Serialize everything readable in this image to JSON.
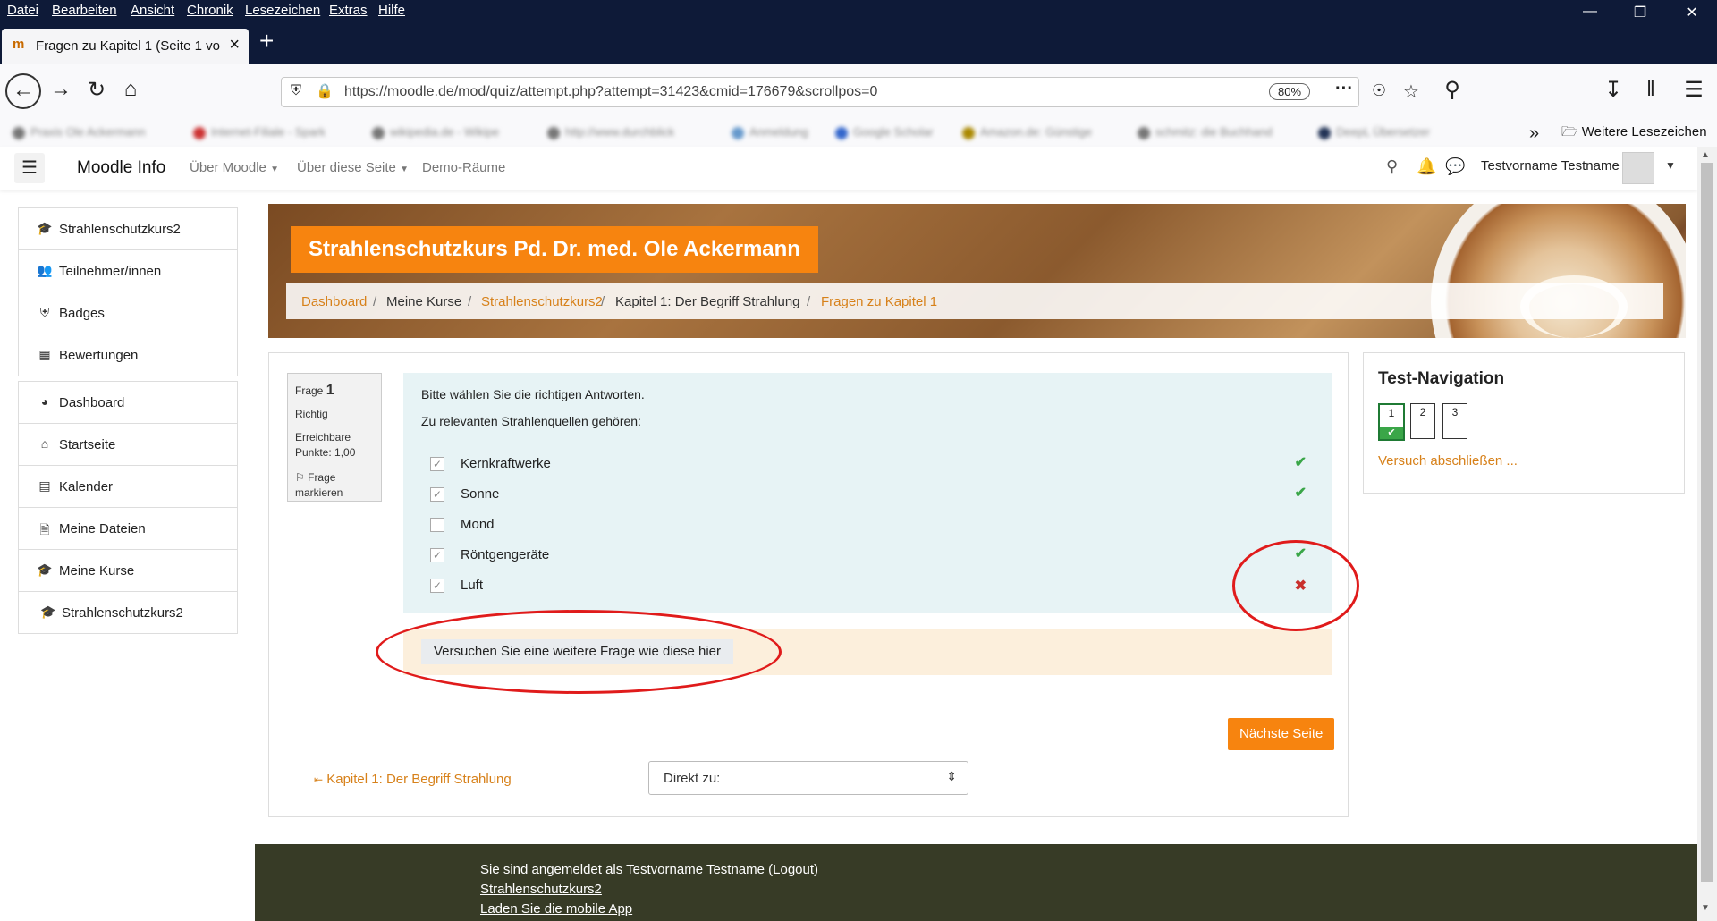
{
  "browser": {
    "menu": [
      "Datei",
      "Bearbeiten",
      "Ansicht",
      "Chronik",
      "Lesezeichen",
      "Extras",
      "Hilfe"
    ],
    "tab_title": "Fragen zu Kapitel 1 (Seite 1 von",
    "url": "https://moodle.de/mod/quiz/attempt.php?attempt=31423&cmid=176679&scrollpos=0",
    "zoom": "80%",
    "bookmarks_folder": "Weitere Lesezeichen",
    "bookmarks_blurred": [
      "Praxis Ole Ackermann",
      "Internet-Filiale - Spark",
      "wikipedia.de - Wikipe",
      "http://www.durchblick",
      "Anmeldung",
      "Google Scholar",
      "Amazon.de: Günstige",
      "schmitz: die Buchhand",
      "DeepL Übersetzer"
    ]
  },
  "moodle": {
    "brand": "Moodle Info",
    "nav": [
      "Über Moodle",
      "Über diese Seite",
      "Demo-Räume"
    ],
    "user_name": "Testvorname Testname"
  },
  "sidebar": {
    "items": [
      {
        "icon": "graduation-cap-icon",
        "label": "Strahlenschutzkurs2"
      },
      {
        "icon": "users-icon",
        "label": "Teilnehmer/innen"
      },
      {
        "icon": "badge-shield-icon",
        "label": "Badges"
      },
      {
        "icon": "table-icon",
        "label": "Bewertungen"
      },
      {
        "icon": "dashboard-icon",
        "label": "Dashboard"
      },
      {
        "icon": "home-icon",
        "label": "Startseite"
      },
      {
        "icon": "calendar-icon",
        "label": "Kalender"
      },
      {
        "icon": "file-icon",
        "label": "Meine Dateien"
      },
      {
        "icon": "graduation-cap-icon",
        "label": "Meine Kurse"
      },
      {
        "icon": "graduation-cap-icon",
        "label": "Strahlenschutzkurs2"
      }
    ]
  },
  "course": {
    "title": "Strahlenschutzkurs Pd. Dr. med. Ole Ackermann",
    "breadcrumb": [
      {
        "label": "Dashboard",
        "link": true
      },
      {
        "label": "Meine Kurse",
        "link": false
      },
      {
        "label": "Strahlenschutzkurs2",
        "link": true
      },
      {
        "label": "Kapitel 1: Der Begriff Strahlung",
        "link": false
      },
      {
        "label": "Fragen zu Kapitel 1",
        "link": true
      }
    ],
    "separator": "/"
  },
  "question": {
    "label": "Frage",
    "number": "1",
    "status": "Richtig",
    "points": "Erreichbare Punkte: 1,00",
    "flag": "Frage markieren",
    "instruction": "Bitte wählen Sie die richtigen Antworten.",
    "text": "Zu relevanten Strahlenquellen gehören:",
    "answers": [
      {
        "label": "Kernkraftwerke",
        "checked": true,
        "mark": "correct"
      },
      {
        "label": "Sonne",
        "checked": true,
        "mark": "correct"
      },
      {
        "label": "Mond",
        "checked": false,
        "mark": "none"
      },
      {
        "label": "Röntgengeräte",
        "checked": true,
        "mark": "correct"
      },
      {
        "label": "Luft",
        "checked": true,
        "mark": "incorrect"
      }
    ],
    "redo_label": "Versuchen Sie eine weitere Frage wie diese hier",
    "next_label": "Nächste Seite",
    "prev_link": "Kapitel 1: Der Begriff Strahlung",
    "jump_label": "Direkt zu:"
  },
  "test_nav": {
    "title": "Test-Navigation",
    "questions": [
      "1",
      "2",
      "3"
    ],
    "current": "1",
    "finish_label": "Versuch abschließen ..."
  },
  "footer": {
    "logged_in_prefix": "Sie sind angemeldet als",
    "user": "Testvorname Testname",
    "logout": "Logout",
    "course_link": "Strahlenschutzkurs2",
    "app_link": "Laden Sie die mobile App"
  },
  "colors": {
    "accent": "#f7840f",
    "link": "#d7811a",
    "correct": "#3aa648",
    "incorrect": "#c9302c",
    "question_bg": "#e7f3f5",
    "redo_bg": "#fcefdc",
    "footer_bg": "#373b26",
    "annotation": "#e01b1b"
  }
}
